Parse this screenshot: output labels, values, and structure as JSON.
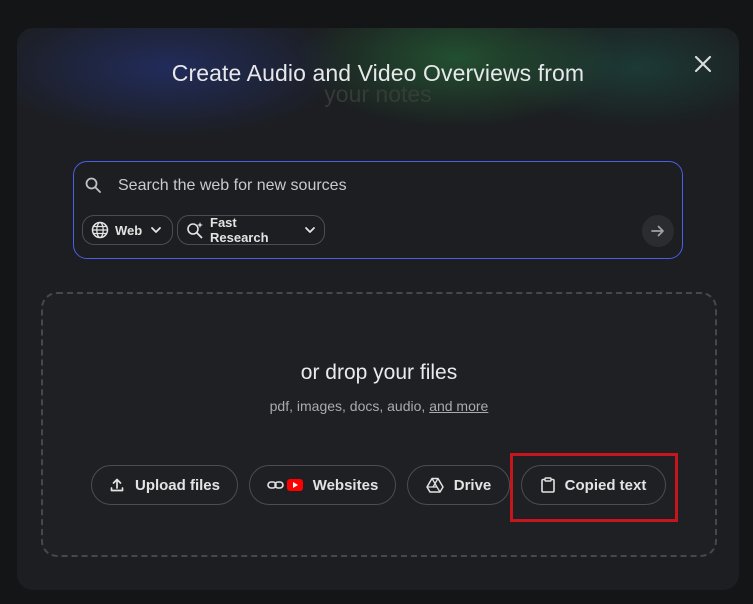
{
  "dialog": {
    "title": "Create Audio and Video Overviews from",
    "title_line2": "your notes"
  },
  "search": {
    "placeholder": "Search the web for new sources",
    "value": "",
    "source_chip": "Web",
    "mode_chip": "Fast Research"
  },
  "dropzone": {
    "title": "or drop your files",
    "subtitle": "pdf, images, docs, audio,",
    "more_link": "and more"
  },
  "sources": [
    {
      "label": "Upload files",
      "icon": "upload-icon"
    },
    {
      "label": "Websites",
      "icon": "link-youtube-icon"
    },
    {
      "label": "Drive",
      "icon": "drive-icon"
    },
    {
      "label": "Copied text",
      "icon": "clipboard-icon"
    }
  ],
  "colors": {
    "accent_border": "#4a5ee6",
    "highlight": "#c4161c",
    "youtube_red": "#ff0000",
    "background": "#1c1e21"
  }
}
